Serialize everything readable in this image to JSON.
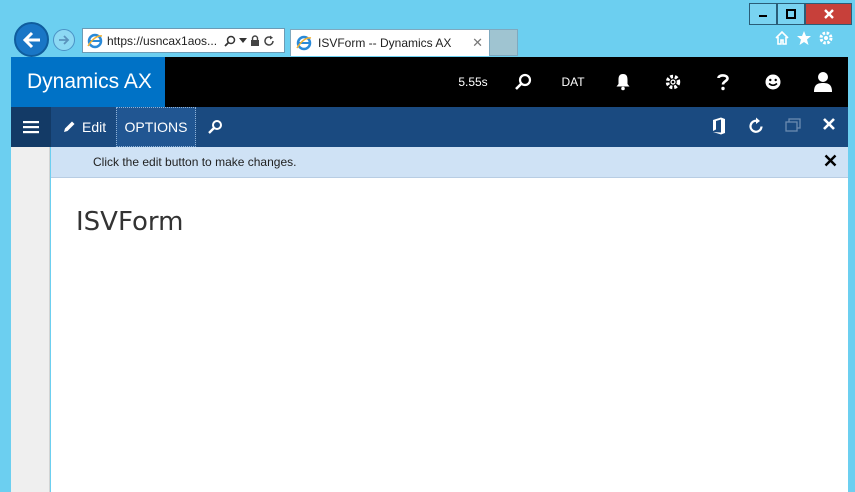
{
  "browser": {
    "address_url": "https://usncax1aos...",
    "tab_title": "ISVForm -- Dynamics AX",
    "tab_close": "✕"
  },
  "header": {
    "brand": "Dynamics AX",
    "timing": "5.55s",
    "company": "DAT"
  },
  "actionpane": {
    "edit_label": "Edit",
    "options_label": "OPTIONS"
  },
  "messagebar": {
    "text": "Click the edit button to make changes."
  },
  "form": {
    "title": "ISVForm"
  }
}
